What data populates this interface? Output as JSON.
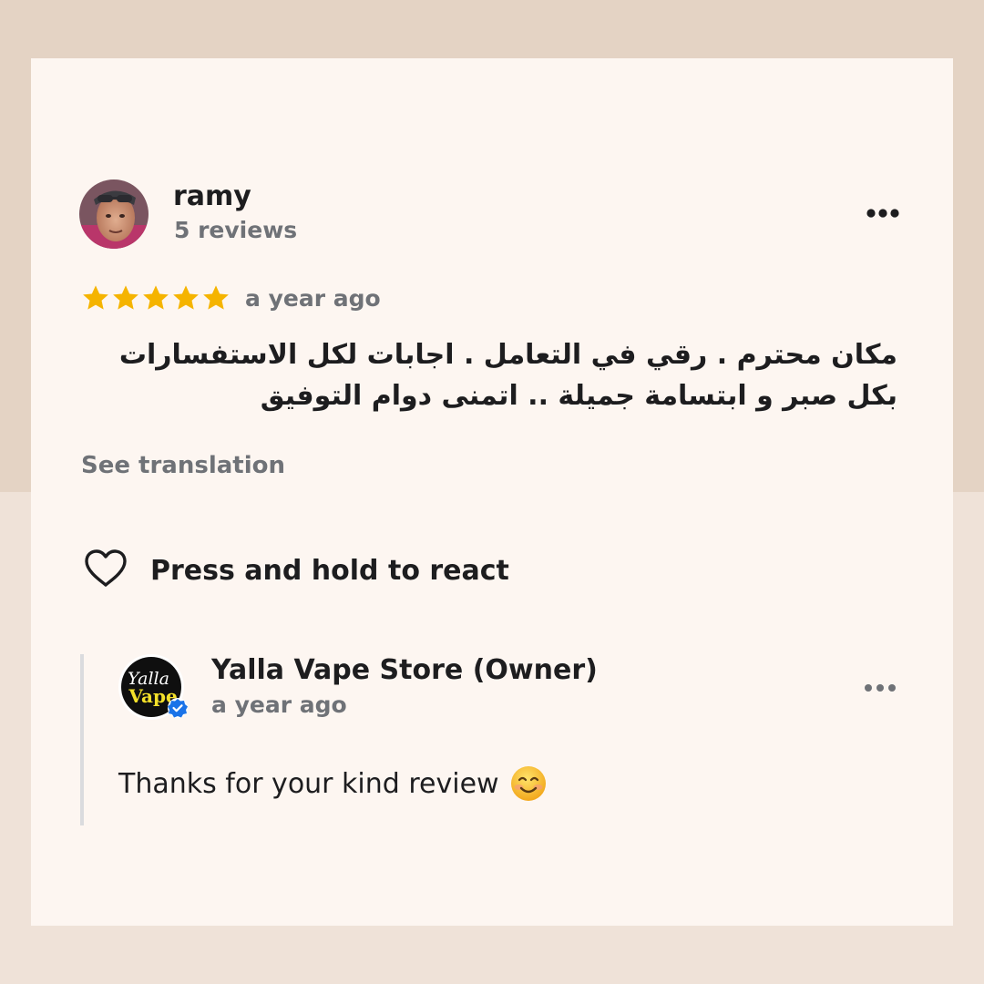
{
  "review": {
    "author": {
      "name": "ramy",
      "meta": "5 reviews",
      "avatar_icon": "user-avatar-photo"
    },
    "rating": 5,
    "rating_max": 5,
    "time": "a year ago",
    "text": "مكان محترم . رقي في التعامل . اجابات لكل الاستفسارات بكل صبر و ابتسامة جميلة .. اتمنى دوام التوفيق",
    "see_translation": "See translation",
    "react_label": "Press and hold to react",
    "more_icon": "more-horizontal-icon",
    "heart_icon": "heart-outline-icon"
  },
  "reply": {
    "owner_name": "Yalla Vape Store (Owner)",
    "time": "a year ago",
    "logo_text": [
      "Yalla",
      "Vape"
    ],
    "verified_icon": "verified-badge-icon",
    "text": "Thanks for your kind review",
    "emoji": "smiling-face-icon"
  },
  "colors": {
    "star": "#f5b400",
    "text_primary": "#1d1d1f",
    "text_secondary": "#6f7277",
    "card_bg": "#fdf6f1",
    "page_bg_top": "#e4d3c4",
    "page_bg_bottom": "#efe2d8",
    "verified": "#1a73e8"
  }
}
